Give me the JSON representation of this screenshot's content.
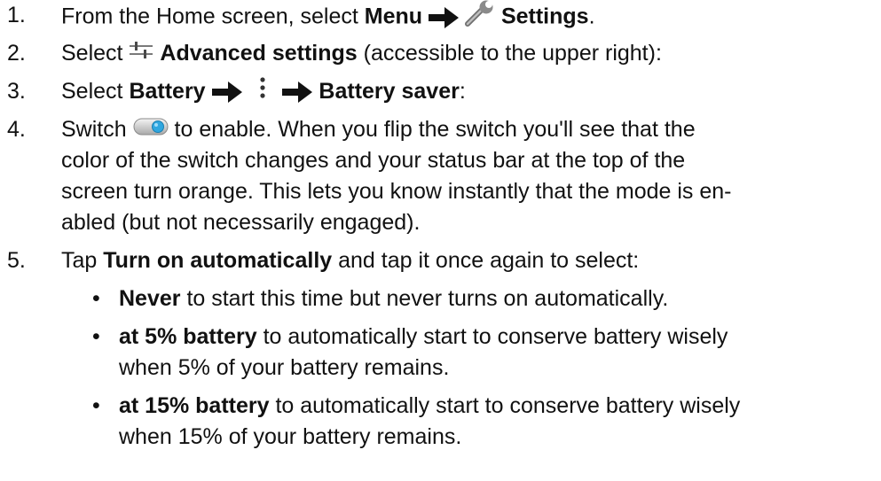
{
  "steps": [
    {
      "num": "1.",
      "pre": "From the Home screen, select ",
      "b1": "Menu",
      "b2": "Settings",
      "post": "."
    },
    {
      "num": "2.",
      "pre": "Select ",
      "b1": "Advanced settings",
      "post": " (accessible to the upper right):"
    },
    {
      "num": "3.",
      "pre": "Select ",
      "b1": "Battery",
      "b2": "Battery saver",
      "post": ":"
    },
    {
      "num": "4.",
      "pre": "Switch ",
      "post": " to enable. When you flip the switch you'll see that the",
      "l2": "color of the switch changes and your status bar at the top of the",
      "l3": "screen turn orange. This lets you know instantly that the mode is en-",
      "l4": "abled (but not necessarily engaged)."
    },
    {
      "num": "5.",
      "pre": "Tap ",
      "b1": "Turn on automatically",
      "post": " and tap it once again to select:"
    }
  ],
  "bullets": [
    {
      "b": "Never",
      "t": " to start this time but never turns on automatically."
    },
    {
      "b": "at 5% battery",
      "t": " to automatically start to conserve battery wisely",
      "t2": "when 5% of your battery remains."
    },
    {
      "b": "at 15% battery",
      "t": " to automatically start to conserve battery wisely",
      "t2": "when 15% of your battery remains."
    }
  ],
  "bullet_char": "•",
  "icons": [
    "arrow-right-icon",
    "wrench-icon",
    "sliders-icon",
    "overflow-menu-icon",
    "toggle-switch-icon"
  ],
  "colors": {
    "text": "#111111",
    "toggle_knob": "#2fa7e0"
  }
}
